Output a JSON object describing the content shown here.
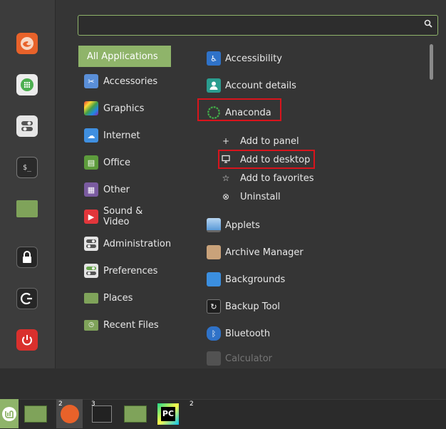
{
  "search": {
    "value": "",
    "placeholder": ""
  },
  "favorites": [
    {
      "name": "firefox-icon"
    },
    {
      "name": "software-manager-icon"
    },
    {
      "name": "settings-icon",
      "glyph": "⊜"
    },
    {
      "name": "terminal-icon",
      "glyph": "$_"
    },
    {
      "name": "files-icon"
    },
    {
      "name": "lock-screen-icon",
      "glyph": "🔒"
    },
    {
      "name": "logout-icon",
      "glyph": "⟳"
    },
    {
      "name": "shutdown-icon",
      "glyph": "⏻"
    }
  ],
  "categories": [
    {
      "label": "All Applications",
      "icon": "all-apps"
    },
    {
      "label": "Accessories",
      "icon": "scissors-icon"
    },
    {
      "label": "Graphics",
      "icon": "graphics-icon"
    },
    {
      "label": "Internet",
      "icon": "cloud-icon"
    },
    {
      "label": "Office",
      "icon": "office-icon"
    },
    {
      "label": "Other",
      "icon": "grid-icon"
    },
    {
      "label": "Sound & Video",
      "icon": "play-icon"
    },
    {
      "label": "Administration",
      "icon": "admin-toggle-icon"
    },
    {
      "label": "Preferences",
      "icon": "preferences-toggle-icon"
    },
    {
      "label": "Places",
      "icon": "folder-icon"
    },
    {
      "label": "Recent Files",
      "icon": "recent-folder-icon"
    }
  ],
  "apps": [
    {
      "label": "Accessibility",
      "icon": "accessibility-icon"
    },
    {
      "label": "Account details",
      "icon": "account-icon"
    },
    {
      "label": "Anaconda",
      "icon": "anaconda-icon"
    },
    {
      "label": "Applets",
      "icon": "applets-icon"
    },
    {
      "label": "Archive Manager",
      "icon": "archive-icon"
    },
    {
      "label": "Backgrounds",
      "icon": "backgrounds-icon"
    },
    {
      "label": "Backup Tool",
      "icon": "backup-icon"
    },
    {
      "label": "Bluetooth",
      "icon": "bluetooth-icon"
    },
    {
      "label": "Calculator",
      "icon": "calculator-icon"
    }
  ],
  "context_menu": [
    {
      "label": "Add to panel",
      "glyph": "+"
    },
    {
      "label": "Add to desktop",
      "glyph": "🖵"
    },
    {
      "label": "Add to favorites",
      "glyph": "☆"
    },
    {
      "label": "Uninstall",
      "glyph": "⊗"
    }
  ],
  "panel": {
    "badges": [
      "2",
      "3",
      "2"
    ],
    "pycharm_label": "PC"
  },
  "colors": {
    "accent": "#8fb46a",
    "highlight_box": "#d8141c"
  }
}
